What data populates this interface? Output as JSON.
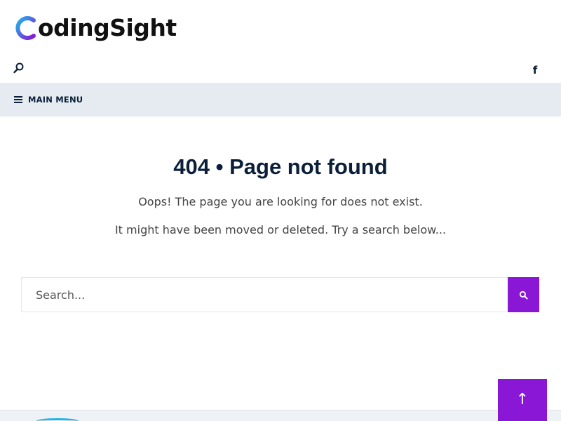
{
  "header": {
    "logo_text": "odingSight",
    "logo_letter": "C",
    "logo_gradient": [
      "#1fb6e8",
      "#8a17d6"
    ],
    "search_icon": "search-icon",
    "social": {
      "facebook_label": "f",
      "icon": "facebook-icon"
    }
  },
  "nav": {
    "menu_label": "MAIN MENU",
    "menu_icon": "hamburger-icon",
    "background": "#e6ebf2"
  },
  "main": {
    "title": "404 • Page not found",
    "message_1": "Oops! The page you are looking for does not exist.",
    "message_2": "It might have been moved or deleted. Try a search below..."
  },
  "search": {
    "placeholder": "Search...",
    "value": "",
    "submit_icon": "search-icon",
    "accent": "#8a17d6"
  },
  "back_to_top": {
    "label": "↑",
    "icon": "arrow-up-icon",
    "color": "#8a17d6"
  },
  "colors": {
    "title": "#0b1f3a",
    "text": "#444444"
  }
}
